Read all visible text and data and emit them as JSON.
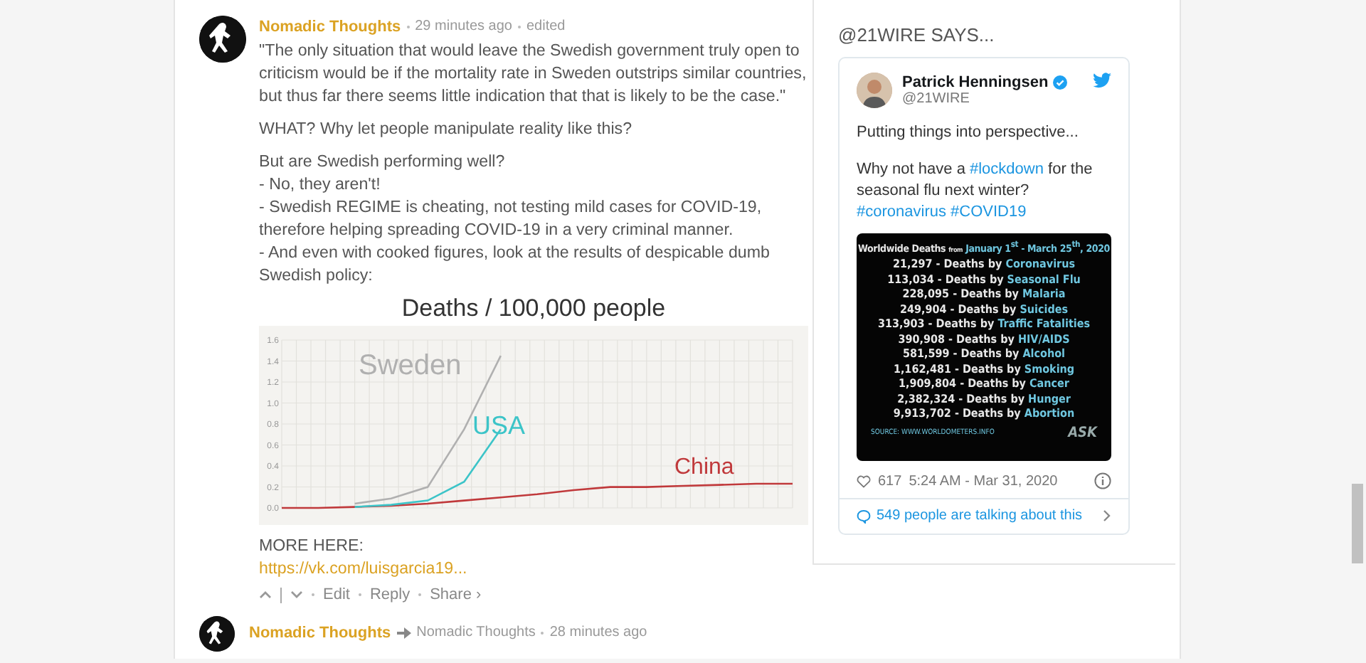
{
  "comment": {
    "author": "Nomadic Thoughts",
    "time": "29 minutes ago",
    "edited": "edited",
    "paragraphs": [
      [
        "\"The only situation that would leave the Swedish government truly open to criticism would be if the mortality rate in Sweden outstrips similar countries, but thus far there seems little indication that that is likely to be the case.\""
      ],
      [
        "WHAT? Why let people manipulate reality like this?"
      ],
      [
        "But are Swedish performing well?",
        "- No, they aren't!",
        "- Swedish REGIME is cheating, not testing mild cases for COVID-19,",
        "therefore helping spreading COVID-19 in a very criminal manner.",
        "- And even with cooked figures, look at the results of despicable dumb Swedish policy:"
      ]
    ],
    "chart_data": {
      "type": "line",
      "title": "Deaths / 100,000 people",
      "categories": [
        null,
        null,
        null,
        null,
        null,
        null,
        null,
        null,
        null,
        null,
        null,
        null,
        null,
        null,
        null
      ],
      "grid": true,
      "ylim": [
        0,
        1.6
      ],
      "yticks": [
        {
          "value": 0,
          "label": "0.0"
        },
        0.2,
        0.4,
        0.6,
        0.8,
        {
          "value": 1,
          "label": "1.0"
        },
        1.2,
        1.4,
        1.6
      ],
      "series": [
        {
          "name": "Sweden",
          "color": "#b0b0b0",
          "values": [
            null,
            null,
            0.04,
            0.09,
            0.2,
            0.75,
            1.45,
            null,
            null,
            null,
            null,
            null,
            null,
            null,
            null
          ]
        },
        {
          "name": "USA",
          "color": "#3cc4c8",
          "values": [
            null,
            null,
            0.01,
            0.03,
            0.07,
            0.25,
            0.75,
            null,
            null,
            null,
            null,
            null,
            null,
            null,
            null
          ]
        },
        {
          "name": "China",
          "color": "#c0393b",
          "values": [
            0,
            0,
            0.01,
            0.02,
            0.04,
            0.07,
            0.1,
            0.13,
            0.17,
            0.2,
            0.2,
            0.21,
            0.22,
            0.23,
            0.23
          ]
        }
      ]
    },
    "more_label": "MORE HERE:",
    "link": "https://vk.com/luisgarcia19...",
    "actions": [
      "Edit",
      "Reply",
      "Share ›"
    ]
  },
  "next_comment": {
    "author": "Nomadic Thoughts",
    "reply_to": "Nomadic Thoughts",
    "time": "28 minutes ago"
  },
  "sidebar": {
    "heading": "@21WIRE SAYS...",
    "tweet": {
      "name": "Patrick Henningsen",
      "handle": "@21WIRE",
      "verified": true,
      "text": [
        "Putting things into perspective...",
        "Why not have a **#lockdown** for the seasonal flu next winter? **#coronavirus** **#COVID19**"
      ],
      "image": {
        "title": "Worldwide Deaths",
        "from": "from",
        "range": "January 1$^{st}$ - March 25$^{th}$, 2020",
        "rows": [
          {
            "count": "21,297",
            "label": "- Deaths by",
            "cause": "Coronavirus"
          },
          {
            "count": "113,034",
            "label": "- Deaths by",
            "cause": "Seasonal Flu"
          },
          {
            "count": "228,095",
            "label": "- Deaths by",
            "cause": "Malaria"
          },
          {
            "count": "249,904",
            "label": "- Deaths by",
            "cause": "Suicides"
          },
          {
            "count": "313,903",
            "label": "- Deaths by",
            "cause": "Traffic Fatalities"
          },
          {
            "count": "390,908",
            "label": "- Deaths by",
            "cause": "HIV/AIDS"
          },
          {
            "count": "581,599",
            "label": "- Deaths by",
            "cause": "Alcohol"
          },
          {
            "count": "1,162,481",
            "label": "- Deaths by",
            "cause": "Smoking"
          },
          {
            "count": "1,909,804",
            "label": "- Deaths by",
            "cause": "Cancer"
          },
          {
            "count": "2,382,324",
            "label": "- Deaths by",
            "cause": "Hunger"
          },
          {
            "count": "9,913,702",
            "label": "- Deaths by",
            "cause": "Abortion"
          }
        ],
        "source": "SOURCE: WWW.WORLDOMETERS.INFO",
        "logo": "ASK"
      },
      "likes": "617",
      "timestamp": "5:24 AM - Mar 31, 2020",
      "talking": "549 people are talking about this"
    }
  }
}
